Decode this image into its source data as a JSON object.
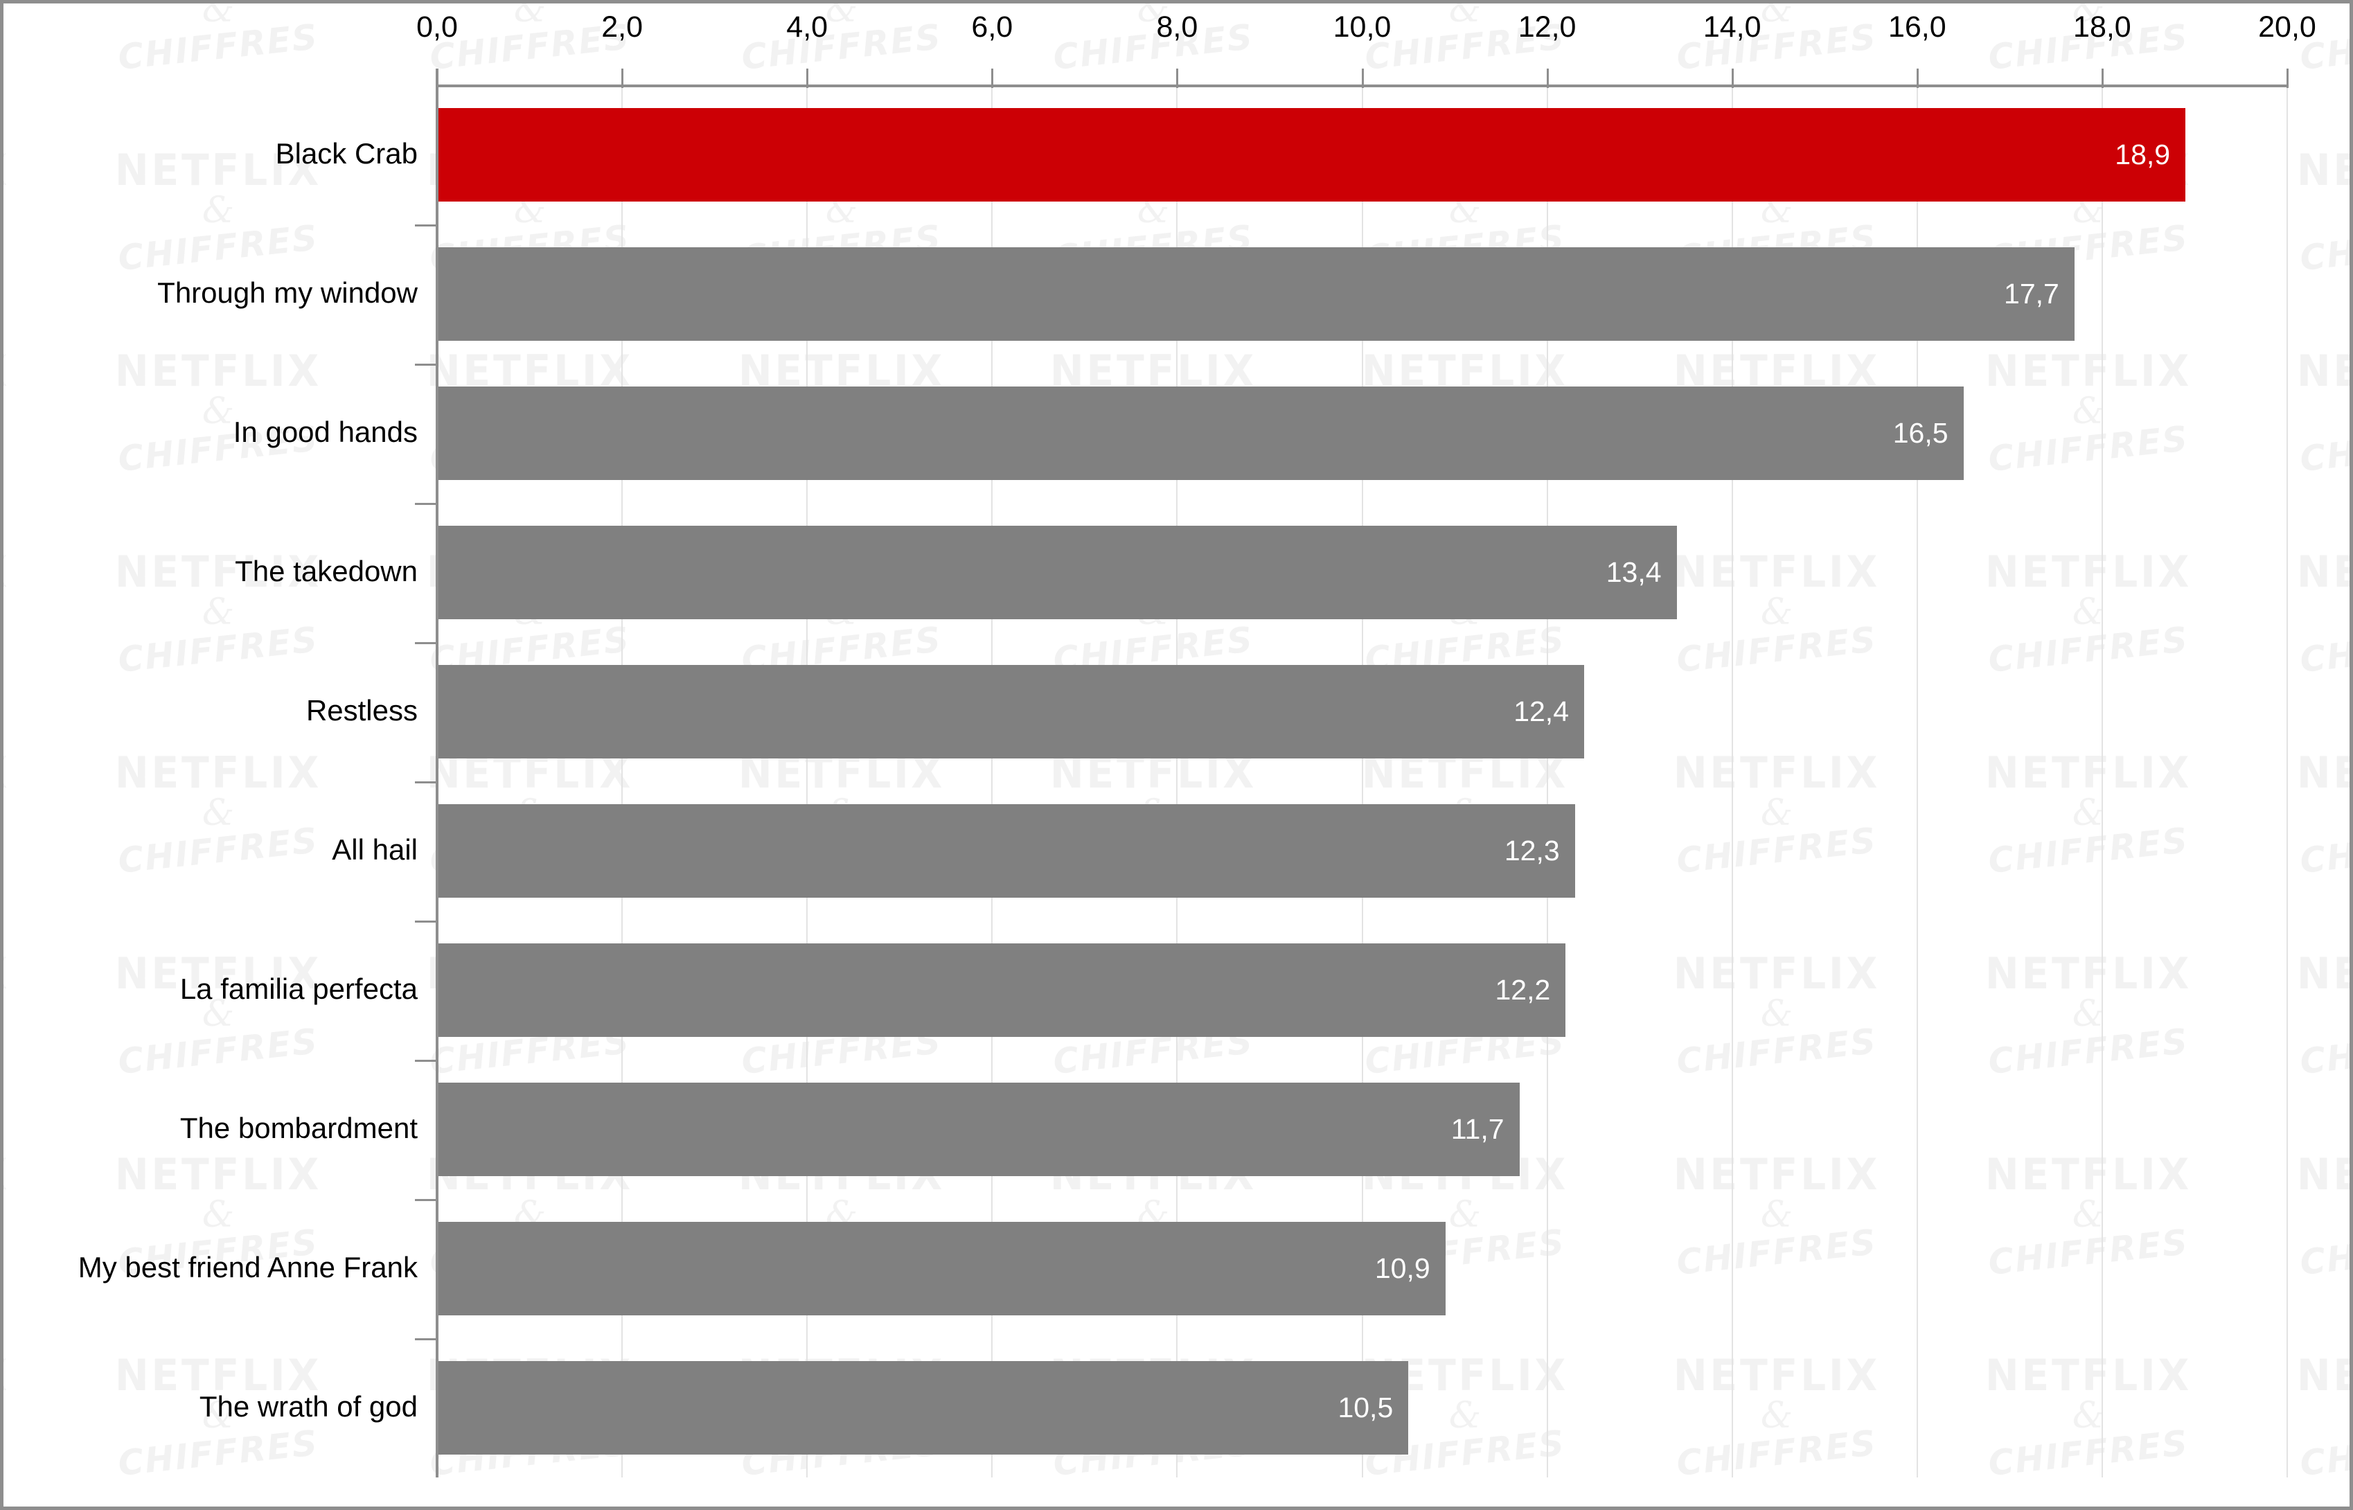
{
  "chart_data": {
    "type": "bar",
    "orientation": "horizontal",
    "title": "",
    "subtitle": "",
    "xlabel": "",
    "ylabel": "",
    "xlim": [
      0,
      20
    ],
    "axis_position": "top",
    "grid": true,
    "legend": false,
    "decimal_separator": ",",
    "categories": [
      "Black Crab",
      "Through my window",
      "In good hands",
      "The takedown",
      "Restless",
      "All hail",
      "La familia perfecta",
      "The bombardment",
      "My best friend Anne Frank",
      "The wrath of god"
    ],
    "values": [
      18.9,
      17.7,
      16.5,
      13.4,
      12.4,
      12.3,
      12.2,
      11.7,
      10.9,
      10.5
    ],
    "value_labels": [
      "18,9",
      "17,7",
      "16,5",
      "13,4",
      "12,4",
      "12,3",
      "12,2",
      "11,7",
      "10,9",
      "10,5"
    ],
    "xticks": [
      0,
      2,
      4,
      6,
      8,
      10,
      12,
      14,
      16,
      18,
      20
    ],
    "xtick_labels": [
      "0,0",
      "2,0",
      "4,0",
      "6,0",
      "8,0",
      "10,0",
      "12,0",
      "14,0",
      "16,0",
      "18,0",
      "20,0"
    ],
    "bar_colors": [
      "#cc0005",
      "#808080",
      "#808080",
      "#808080",
      "#808080",
      "#808080",
      "#808080",
      "#808080",
      "#808080",
      "#808080"
    ],
    "highlight_index": 0,
    "colors": {
      "highlight": "#cc0005",
      "default_bar": "#808080",
      "gridline": "#e3e3e3",
      "axis": "#8e8e8e",
      "value_label": "#ffffff",
      "category_label": "#000000",
      "tick_label": "#000000",
      "background": "#ffffff",
      "watermark": "#f2f2f2"
    }
  },
  "watermark": {
    "line1": "NETFLIX",
    "line2": "&",
    "line3": "CHIFFRES"
  }
}
